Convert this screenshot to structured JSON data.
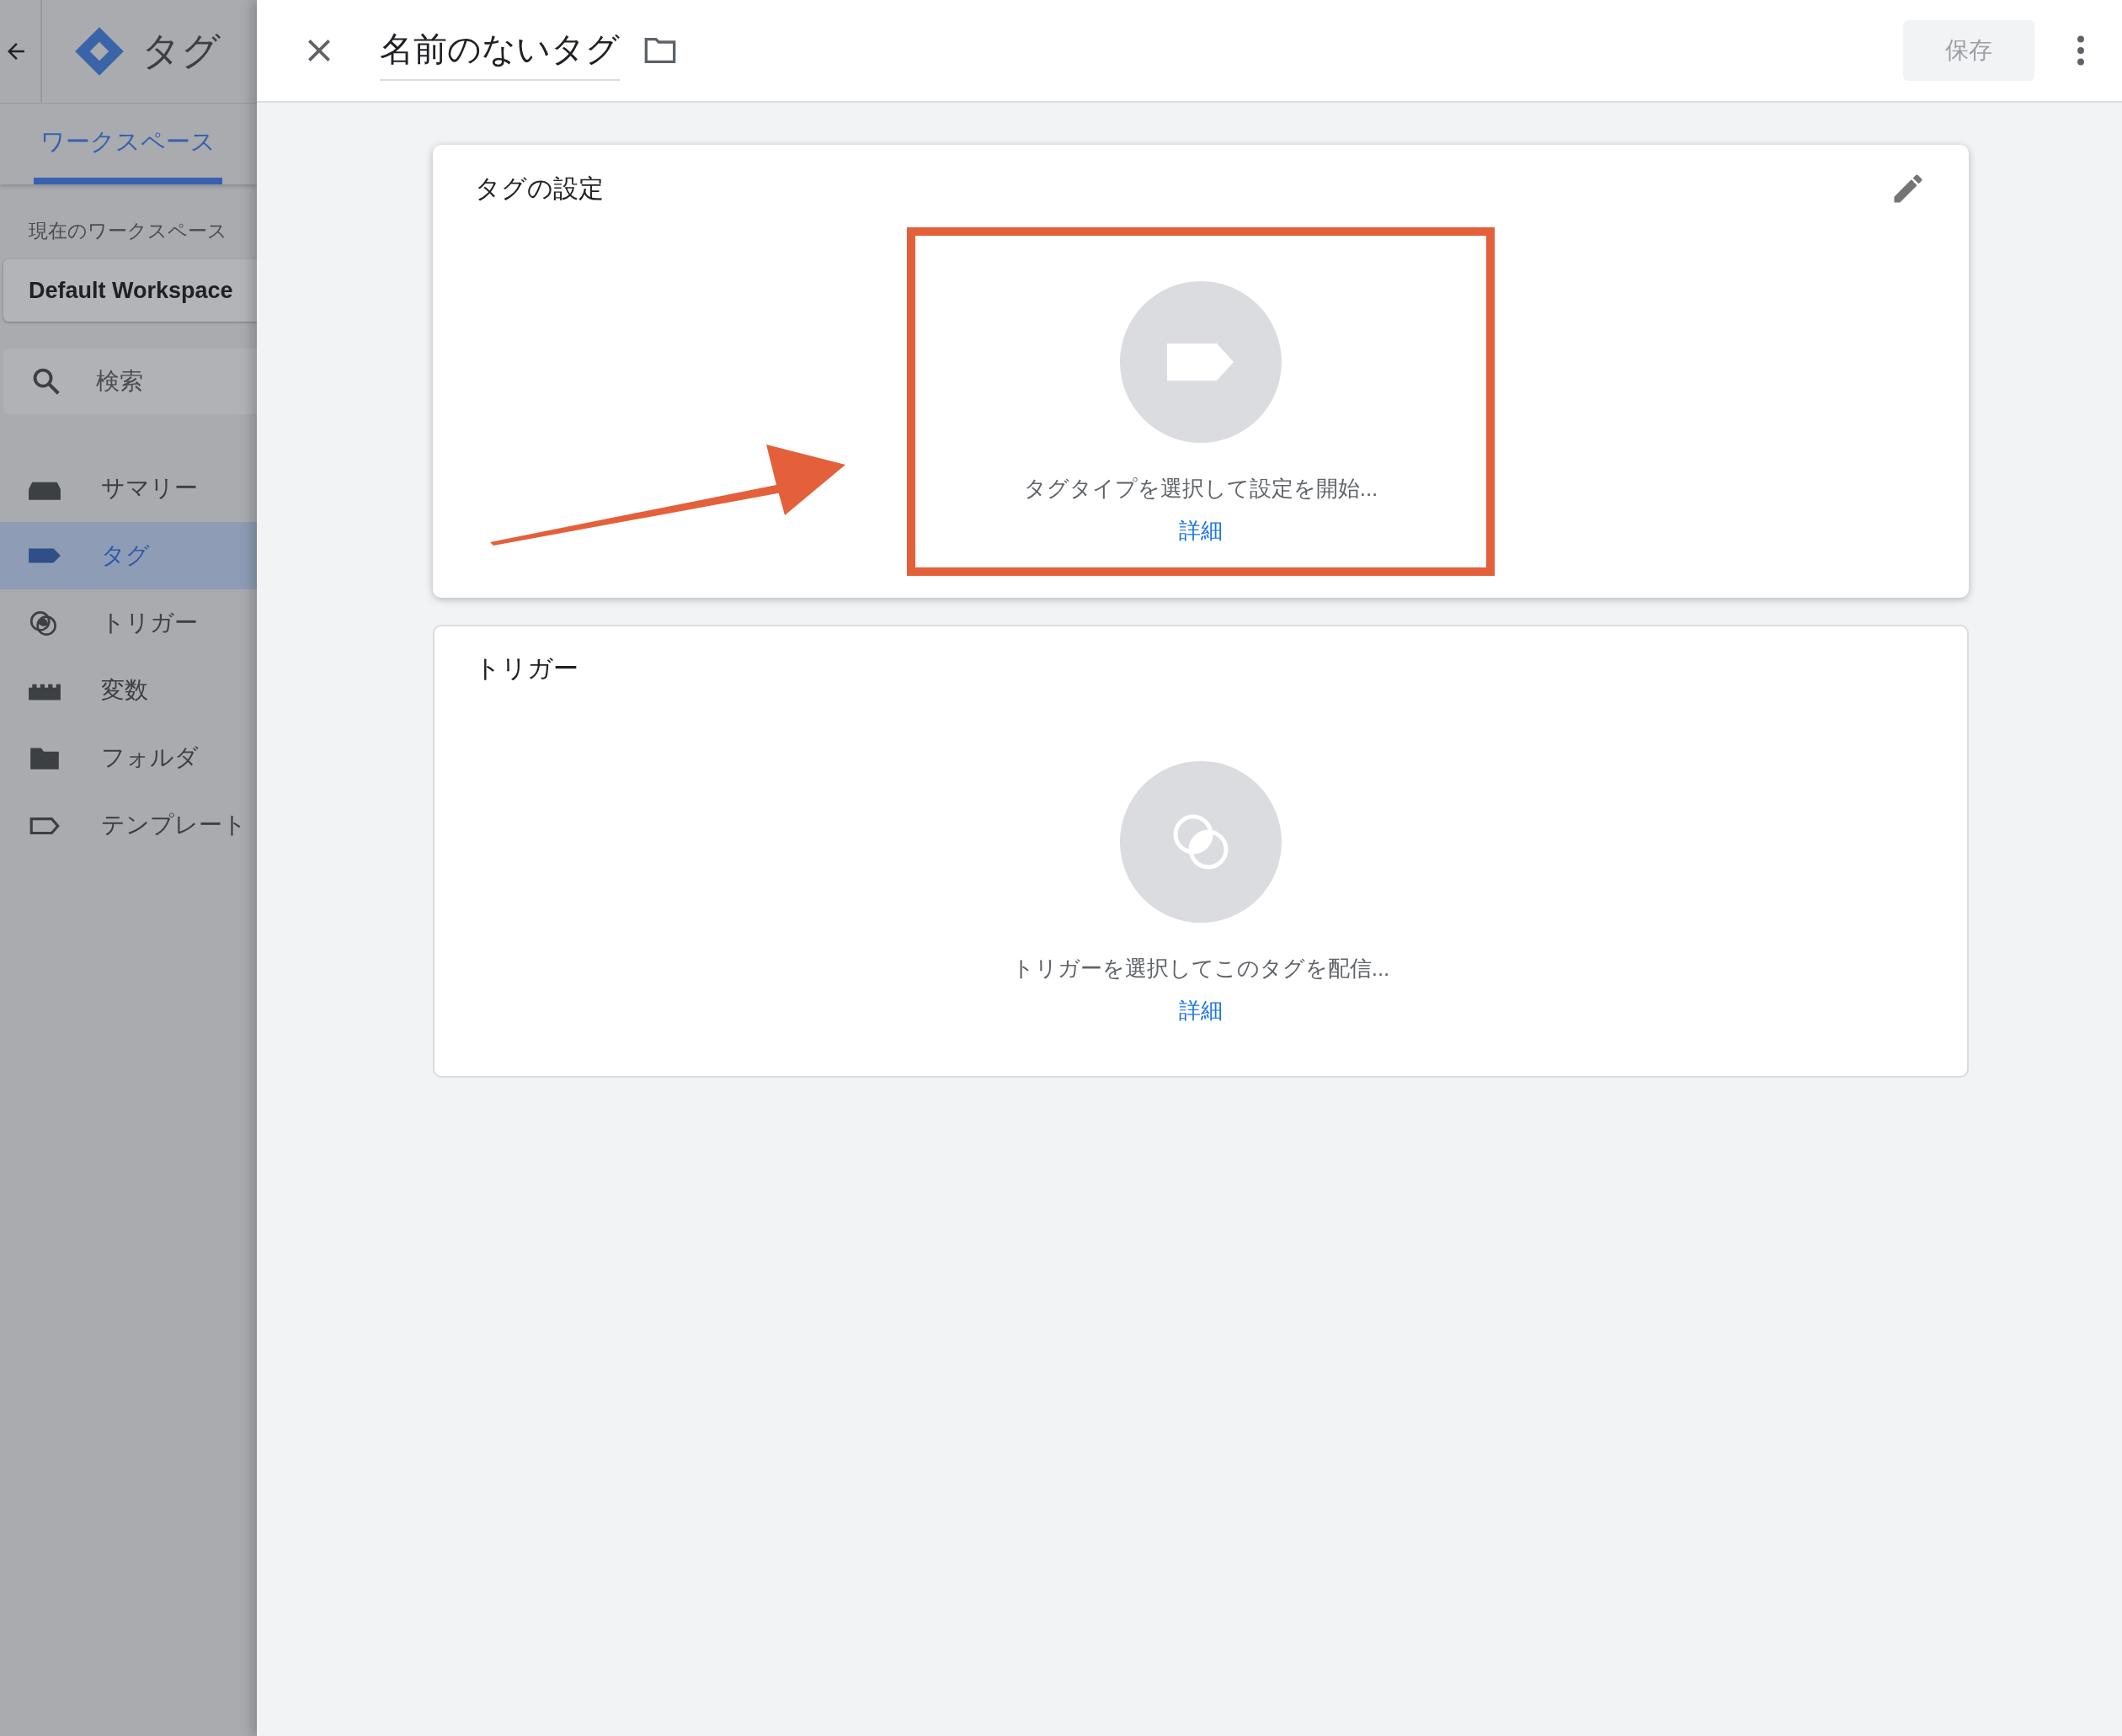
{
  "sidebar": {
    "product_title": "タグ",
    "tabs": [
      {
        "label": "ワークスペース",
        "selected": true
      }
    ],
    "workspace_label": "現在のワークスペース",
    "workspace_name": "Default Workspace",
    "search": {
      "placeholder": "検索"
    },
    "nav_items": [
      {
        "kind": "summary",
        "label": "サマリー",
        "selected": false
      },
      {
        "kind": "tag",
        "label": "タグ",
        "selected": true
      },
      {
        "kind": "trigger",
        "label": "トリガー",
        "selected": false
      },
      {
        "kind": "variable",
        "label": "変数",
        "selected": false
      },
      {
        "kind": "folder",
        "label": "フォルダ",
        "selected": false
      },
      {
        "kind": "template",
        "label": "テンプレート",
        "selected": false
      }
    ]
  },
  "editor": {
    "title": "名前のないタグ",
    "save_button": {
      "label": "保存",
      "disabled": true
    },
    "cards": [
      {
        "kind": "tag",
        "title": "タグの設定",
        "editable": true,
        "highlighted": true,
        "prompt": "タグタイプを選択して設定を開始...",
        "link": "詳細"
      },
      {
        "kind": "trigger",
        "title": "トリガー",
        "editable": false,
        "highlighted": false,
        "prompt": "トリガーを選択してこのタグを配信...",
        "link": "詳細"
      }
    ]
  }
}
